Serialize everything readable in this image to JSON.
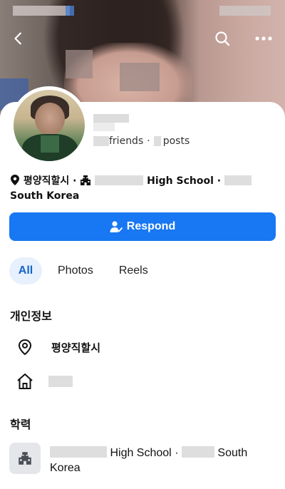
{
  "profile": {
    "friends_label": "friends",
    "separator": "·",
    "posts_label": "posts",
    "location": "평양직할시",
    "school_suffix": "High School",
    "country": "South Korea"
  },
  "actions": {
    "respond_label": "Respond"
  },
  "tabs": [
    {
      "label": "All"
    },
    {
      "label": "Photos"
    },
    {
      "label": "Reels"
    }
  ],
  "personal_info": {
    "title": "개인정보",
    "location": "평양직할시"
  },
  "education": {
    "title": "학력",
    "school_suffix": "High School",
    "country": "South Korea"
  },
  "colors": {
    "primary_blue": "#1877f2",
    "tab_active_bg": "#e7f0fd"
  }
}
